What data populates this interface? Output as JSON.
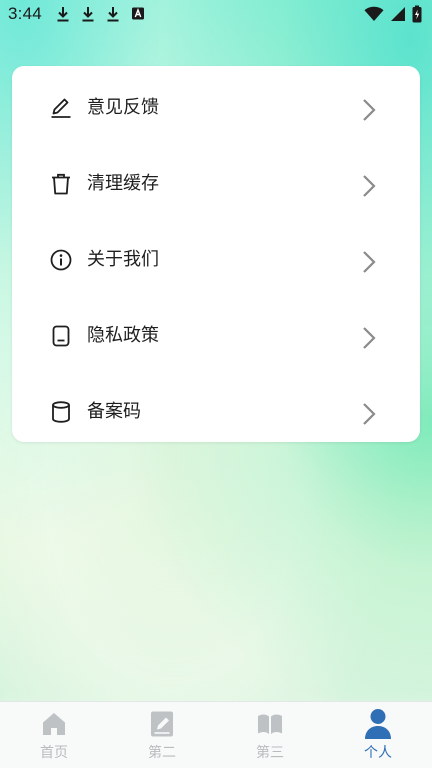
{
  "status_bar": {
    "time": "3:44",
    "left_icons": [
      "download-icon",
      "download-icon",
      "download-icon",
      "a-badge-icon"
    ],
    "right_icons": [
      "wifi-icon",
      "signal-icon",
      "battery-icon"
    ]
  },
  "settings": {
    "items": [
      {
        "label": "意见反馈",
        "icon": "edit-icon"
      },
      {
        "label": "清理缓存",
        "icon": "trash-icon"
      },
      {
        "label": "关于我们",
        "icon": "info-icon"
      },
      {
        "label": "隐私政策",
        "icon": "document-icon"
      },
      {
        "label": "备案码",
        "icon": "database-icon"
      }
    ]
  },
  "bottom_nav": {
    "items": [
      {
        "label": "首页",
        "icon": "home-icon",
        "active": false
      },
      {
        "label": "第二",
        "icon": "pencil-book-icon",
        "active": false
      },
      {
        "label": "第三",
        "icon": "open-book-icon",
        "active": false
      },
      {
        "label": "个人",
        "icon": "person-icon",
        "active": true
      }
    ]
  },
  "colors": {
    "active_accent": "#2f6fb5",
    "inactive": "#b9bcbf",
    "chevron": "#8a8a8a"
  }
}
